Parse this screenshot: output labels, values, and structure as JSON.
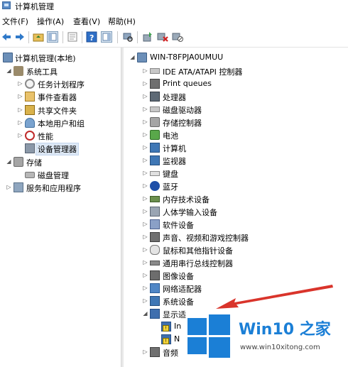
{
  "window": {
    "title": "计算机管理"
  },
  "menubar": [
    {
      "label": "文件(F)"
    },
    {
      "label": "操作(A)"
    },
    {
      "label": "查看(V)"
    },
    {
      "label": "帮助(H)"
    }
  ],
  "toolbar": {
    "icons": [
      "back-arrow-icon",
      "forward-arrow-icon",
      "up-folder-icon",
      "show-tree-icon",
      "properties-icon",
      "help-icon",
      "show-hide-action-pane-icon",
      "scan-hardware-icon",
      "update-driver-icon",
      "uninstall-device-icon",
      "disable-device-icon"
    ]
  },
  "left_tree": {
    "root": "计算机管理(本地)",
    "items": [
      {
        "label": "系统工具"
      },
      {
        "label": "任务计划程序"
      },
      {
        "label": "事件查看器"
      },
      {
        "label": "共享文件夹"
      },
      {
        "label": "本地用户和组"
      },
      {
        "label": "性能"
      },
      {
        "label": "设备管理器"
      },
      {
        "label": "存储"
      },
      {
        "label": "磁盘管理"
      },
      {
        "label": "服务和应用程序"
      }
    ]
  },
  "device_tree": {
    "root": "WIN-T8FPJA0UMUU",
    "items": [
      {
        "label": "IDE ATA/ATAPI 控制器"
      },
      {
        "label": "Print queues"
      },
      {
        "label": "处理器"
      },
      {
        "label": "磁盘驱动器"
      },
      {
        "label": "存储控制器"
      },
      {
        "label": "电池"
      },
      {
        "label": "计算机"
      },
      {
        "label": "监视器"
      },
      {
        "label": "键盘"
      },
      {
        "label": "蓝牙"
      },
      {
        "label": "内存技术设备"
      },
      {
        "label": "人体学输入设备"
      },
      {
        "label": "软件设备"
      },
      {
        "label": "声音、视频和游戏控制器"
      },
      {
        "label": "鼠标和其他指针设备"
      },
      {
        "label": "通用串行总线控制器"
      },
      {
        "label": "图像设备"
      },
      {
        "label": "网络适配器"
      },
      {
        "label": "系统设备"
      },
      {
        "label": "显示适"
      },
      {
        "label": "In"
      },
      {
        "label": "N"
      },
      {
        "label": "音频"
      }
    ]
  },
  "watermark": {
    "title": "Win10 之家",
    "url": "www.win10xitong.com"
  },
  "colors": {
    "accent": "#1b7fd6",
    "arrow": "#d9342b",
    "selection": "#dde8f5"
  }
}
